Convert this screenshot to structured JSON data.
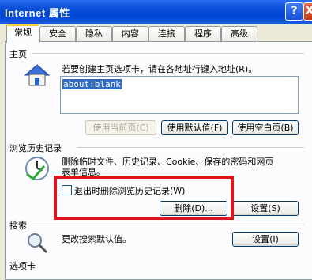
{
  "window": {
    "title": "Internet 属性",
    "help": "?",
    "close": "X"
  },
  "tabs": [
    "常规",
    "安全",
    "隐私",
    "内容",
    "连接",
    "程序",
    "高级"
  ],
  "home": {
    "group_label": "主页",
    "description": "若要创建主页选项卡，请在各地址行键入地址(R)。",
    "address": "about:blank",
    "buttons": {
      "use_current": "使用当前页(C)",
      "use_default": "使用默认值(F)",
      "use_blank": "使用空白页(B)"
    }
  },
  "history": {
    "group_label": "浏览历史记录",
    "description_line1": "删除临时文件、历史记录、Cookie、保存的密码和网页",
    "description_line2": "表单信息。",
    "checkbox_label": "退出时删除浏览历史记录(W)",
    "buttons": {
      "delete": "删除(D)...",
      "settings": "设置(S)"
    }
  },
  "search": {
    "group_label": "搜索",
    "description": "更改搜索默认值。",
    "buttons": {
      "settings": "设置(I)"
    }
  },
  "tabs_group": {
    "group_label": "选项卡"
  },
  "colors": {
    "titlebar": "#0A4FD8",
    "highlight": "#E0141E",
    "selection": "#316AC5"
  }
}
